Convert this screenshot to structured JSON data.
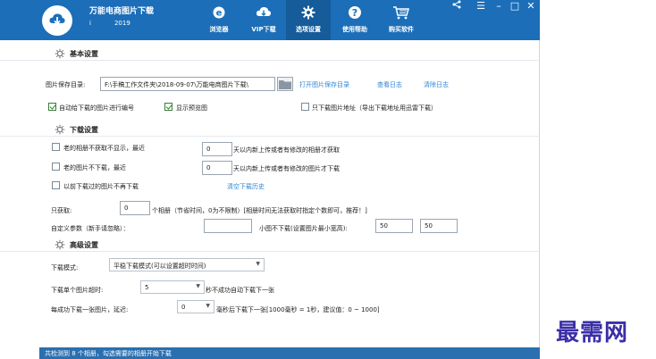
{
  "app": {
    "title": "万能电商图片下载",
    "info_mark": "i",
    "year": "2019"
  },
  "nav": [
    {
      "label": "浏览器",
      "icon": "browser-icon"
    },
    {
      "label": "VIP下载",
      "icon": "cloud-download-icon"
    },
    {
      "label": "选项设置",
      "icon": "gear-icon"
    },
    {
      "label": "使用帮助",
      "icon": "help-icon"
    },
    {
      "label": "购买软件",
      "icon": "cart-icon"
    }
  ],
  "window_controls": {
    "share": "<",
    "menu": "☰",
    "minimize": "–",
    "maximize": "□",
    "close": "✕"
  },
  "basic": {
    "title": "基本设置",
    "save_dir_label": "图片保存目录:",
    "save_dir_value": "F:\\手稿工作文件夹\\2018-09-07\\万能电商图片下载\\",
    "open_dir_link": "打开图片保存目录",
    "view_log_link": "查看日志",
    "clear_log_link": "清除日志",
    "auto_number_label": "自动给下载的图片进行编号",
    "auto_number_checked": true,
    "show_preview_label": "显示预览图",
    "show_preview_checked": true,
    "only_url_label": "只下载图片地址（导出下载地址用迅雷下载）",
    "only_url_checked": false
  },
  "download": {
    "title": "下载设置",
    "old_album_label": "老的相册不获取不显示，最近",
    "old_album_checked": false,
    "old_album_days": "0",
    "old_album_suffix": "天以内新上传或者有修改的相册才获取",
    "old_image_label": "老的图片不下载，最近",
    "old_image_checked": false,
    "old_image_days": "0",
    "old_image_suffix": "天以内新上传或者有修改的图片才下载",
    "skip_downloaded_label": "以前下载过的图片不再下载",
    "skip_downloaded_checked": false,
    "clear_history_link": "清空下载历史",
    "only_fetch_label": "只获取:",
    "only_fetch_value": "0",
    "only_fetch_suffix": "个相册（节省时间，0为不限制）[相册时间无法获取时指定个数即可，推荐！]",
    "custom_param_label": "自定义参数（新手请忽略）：",
    "custom_param_value": "",
    "min_size_label": "小图不下载(设置图片最小宽高):",
    "min_width": "50",
    "min_height": "50"
  },
  "advanced": {
    "title": "高级设置",
    "mode_label": "下载模式:",
    "mode_value": "平稳下载模式(可以设置超时时间)",
    "timeout_label": "下载单个图片超时:",
    "timeout_value": "5",
    "timeout_suffix": "秒不成功自动下载下一张",
    "delay_label": "每成功下载一张图片，延迟:",
    "delay_value": "0",
    "delay_suffix": "毫秒后下载下一张[1000毫秒 = 1秒，建议值：0 ~ 1000]"
  },
  "status": {
    "text": "共检测到 8 个相册，勾选需要的相册开始下载"
  },
  "watermark": {
    "text": "最需网"
  },
  "colors": {
    "header": "#1c6eb8",
    "active_nav": "#165b9a",
    "link": "#2e86d6",
    "watermark": "#3a2ea8"
  }
}
